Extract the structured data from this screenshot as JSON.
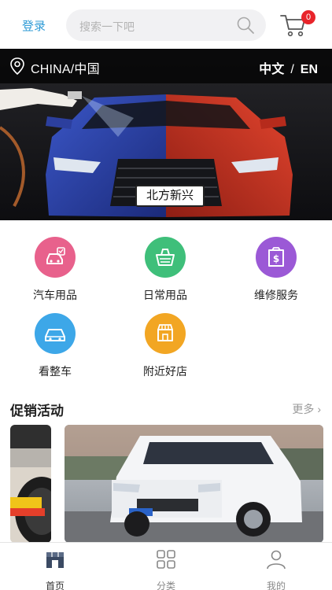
{
  "header": {
    "login_label": "登录",
    "search_placeholder": "搜索一下吧",
    "cart_count": "0"
  },
  "banner": {
    "region": "CHINA/中国",
    "lang_cn": "中文",
    "lang_sep": "/",
    "lang_en": "EN",
    "plate_text": "北方新兴"
  },
  "categories": [
    {
      "label": "汽车用品",
      "icon": "car-accessory-icon",
      "color": "#e8618c"
    },
    {
      "label": "日常用品",
      "icon": "basket-icon",
      "color": "#3fbf7a"
    },
    {
      "label": "维修服务",
      "icon": "repair-service-icon",
      "color": "#9b59d6"
    },
    {
      "label": "看整车",
      "icon": "car-icon",
      "color": "#3da7e8"
    },
    {
      "label": "附近好店",
      "icon": "store-icon",
      "color": "#f2a623"
    }
  ],
  "promo": {
    "title": "促销活动",
    "more_label": "更多"
  },
  "tabbar": [
    {
      "label": "首页",
      "icon": "home-store-icon"
    },
    {
      "label": "分类",
      "icon": "grid-icon"
    },
    {
      "label": "我的",
      "icon": "user-icon"
    }
  ]
}
